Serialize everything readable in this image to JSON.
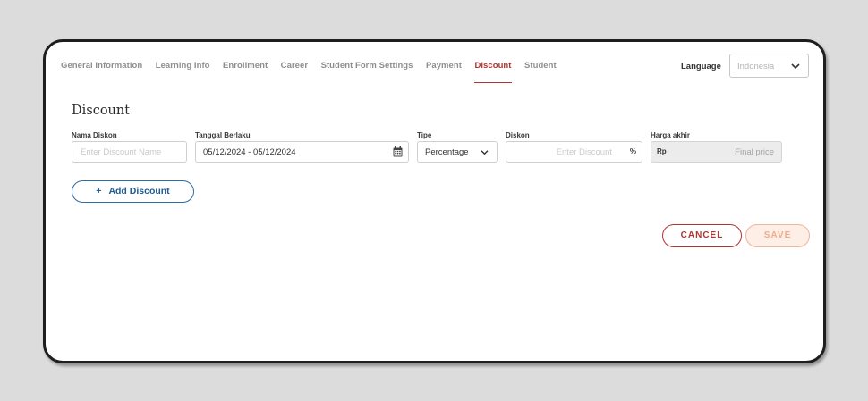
{
  "tabs": [
    {
      "label": "General Information"
    },
    {
      "label": "Learning Info"
    },
    {
      "label": "Enrollment"
    },
    {
      "label": "Career"
    },
    {
      "label": "Student Form Settings"
    },
    {
      "label": "Payment"
    },
    {
      "label": "Discount",
      "active": true
    },
    {
      "label": "Student"
    }
  ],
  "language": {
    "label": "Language",
    "selected": "Indonesia"
  },
  "section": {
    "title": "Discount"
  },
  "form": {
    "name": {
      "label": "Nama Diskon",
      "placeholder": "Enter Discount Name"
    },
    "date": {
      "label": "Tanggal Berlaku",
      "value": "05/12/2024 - 05/12/2024"
    },
    "type": {
      "label": "Tipe",
      "selected": "Percentage"
    },
    "discount": {
      "label": "Diskon",
      "placeholder": "Enter Discount",
      "unit": "%"
    },
    "final": {
      "label": "Harga akhir",
      "prefix": "Rp",
      "placeholder": "Final price"
    }
  },
  "actions": {
    "add": "Add Discount",
    "add_icon": "+",
    "cancel": "CANCEL",
    "save": "SAVE"
  },
  "colors": {
    "accent": "#b0362f",
    "link": "#1d5c94",
    "save_disabled": "#f0ac8e"
  }
}
